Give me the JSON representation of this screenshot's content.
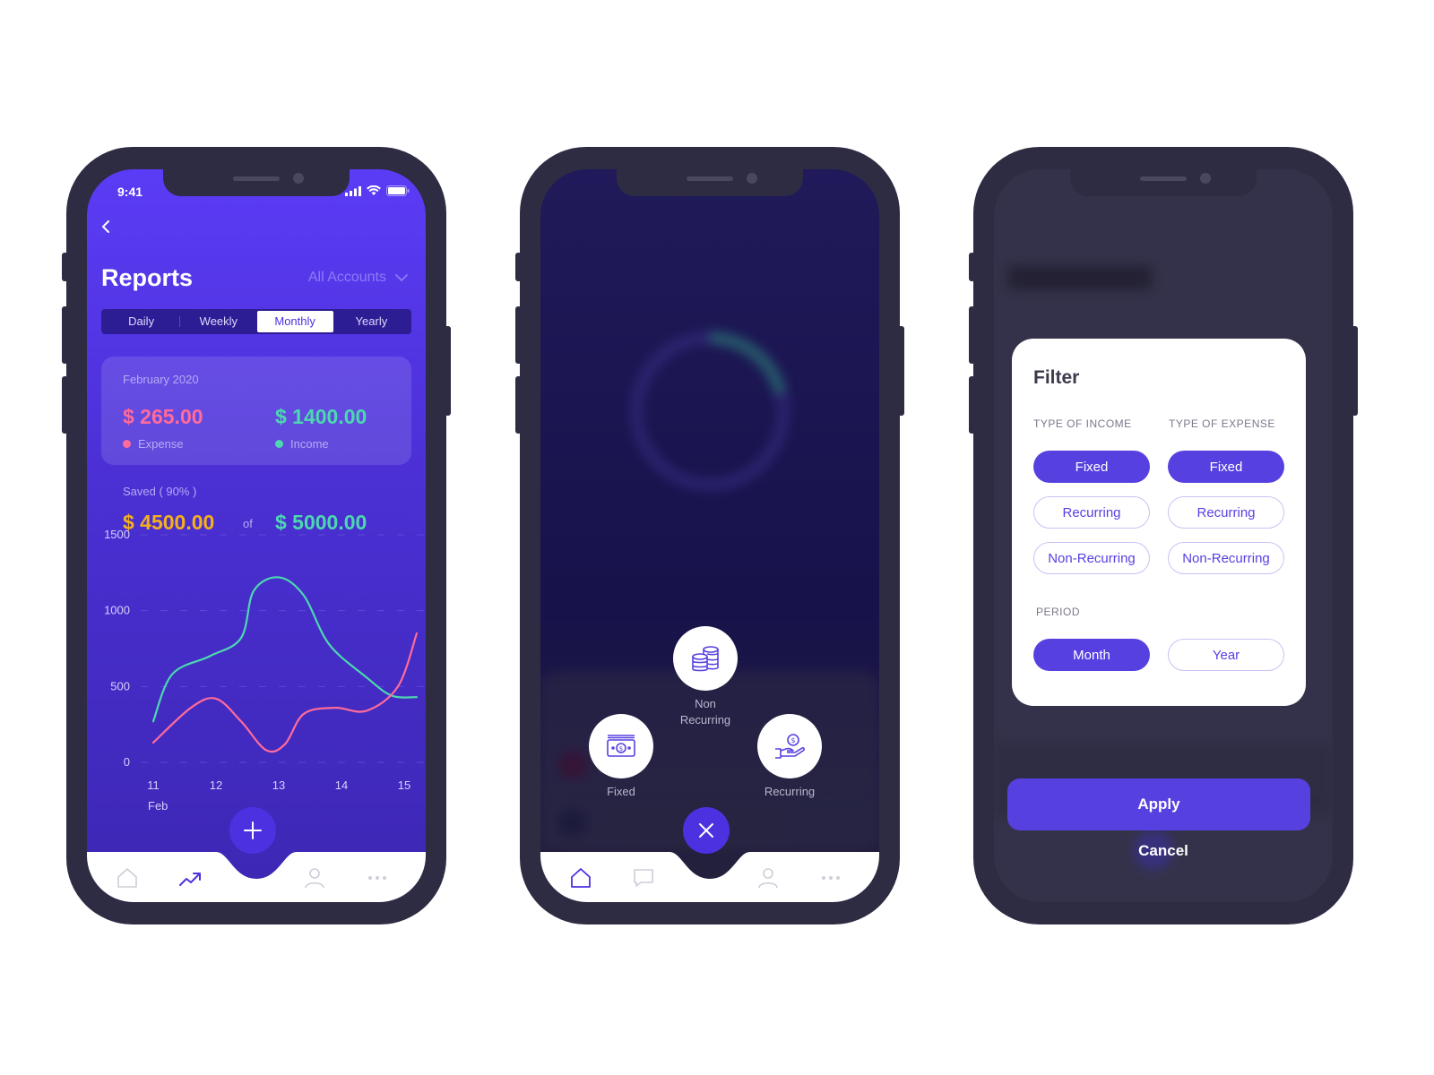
{
  "colors": {
    "accent": "#5641e0",
    "expense": "#ff6b9a",
    "income": "#4cd8b0",
    "saved": "#f5b01e"
  },
  "screen1": {
    "status_time": "9:41",
    "title": "Reports",
    "account_select": "All Accounts",
    "tabs": [
      "Daily",
      "Weekly",
      "Monthly",
      "Yearly"
    ],
    "active_tab": "Monthly",
    "summary": {
      "date": "February 2020",
      "expense_amount": "$ 265.00",
      "expense_label": "Expense",
      "income_amount": "$ 1400.00",
      "income_label": "Income"
    },
    "saved": {
      "label": "Saved ( 90% )",
      "amount": "$ 4500.00",
      "of": "of",
      "total": "$ 5000.00"
    },
    "tabbar_icons": [
      "home-icon",
      "trend-icon",
      "user-icon",
      "more-icon"
    ]
  },
  "chart_data": {
    "type": "line",
    "x": [
      11,
      12,
      13,
      14,
      15
    ],
    "xticks": [
      "11",
      "12",
      "13",
      "14",
      "15"
    ],
    "xlabel": "Feb",
    "yticks": [
      "1500",
      "1000",
      "500",
      "0"
    ],
    "ylim": [
      0,
      1500
    ],
    "grid": true,
    "series": [
      {
        "name": "Income",
        "color": "#4cd8b0",
        "points": [
          [
            11,
            270
          ],
          [
            11.3,
            580
          ],
          [
            11.9,
            700
          ],
          [
            12.4,
            820
          ],
          [
            12.6,
            1130
          ],
          [
            13,
            1220
          ],
          [
            13.4,
            1100
          ],
          [
            13.8,
            780
          ],
          [
            14.4,
            560
          ],
          [
            14.8,
            440
          ],
          [
            15.2,
            430
          ]
        ]
      },
      {
        "name": "Expense",
        "color": "#ff6b9a",
        "points": [
          [
            11,
            130
          ],
          [
            11.6,
            360
          ],
          [
            12,
            420
          ],
          [
            12.4,
            270
          ],
          [
            12.8,
            80
          ],
          [
            13.1,
            120
          ],
          [
            13.4,
            320
          ],
          [
            13.9,
            360
          ],
          [
            14.4,
            340
          ],
          [
            14.9,
            500
          ],
          [
            15.2,
            850
          ]
        ]
      }
    ]
  },
  "screen2": {
    "actions": [
      {
        "label": "Fixed",
        "icon": "cash-icon"
      },
      {
        "label_line1": "Non",
        "label_line2": "Recurring",
        "icon": "coins-icon"
      },
      {
        "label": "Recurring",
        "icon": "hand-money-icon"
      }
    ],
    "tabbar_icons": [
      "home-icon",
      "chat-icon",
      "user-icon",
      "more-icon"
    ]
  },
  "screen3": {
    "filter_title": "Filter",
    "income_label": "TYPE OF INCOME",
    "expense_label": "TYPE OF EXPENSE",
    "income_options": [
      "Fixed",
      "Recurring",
      "Non-Recurring"
    ],
    "expense_options": [
      "Fixed",
      "Recurring",
      "Non-Recurring"
    ],
    "period_label": "PERIOD",
    "period_options": [
      "Month",
      "Year"
    ],
    "apply": "Apply",
    "cancel": "Cancel"
  }
}
